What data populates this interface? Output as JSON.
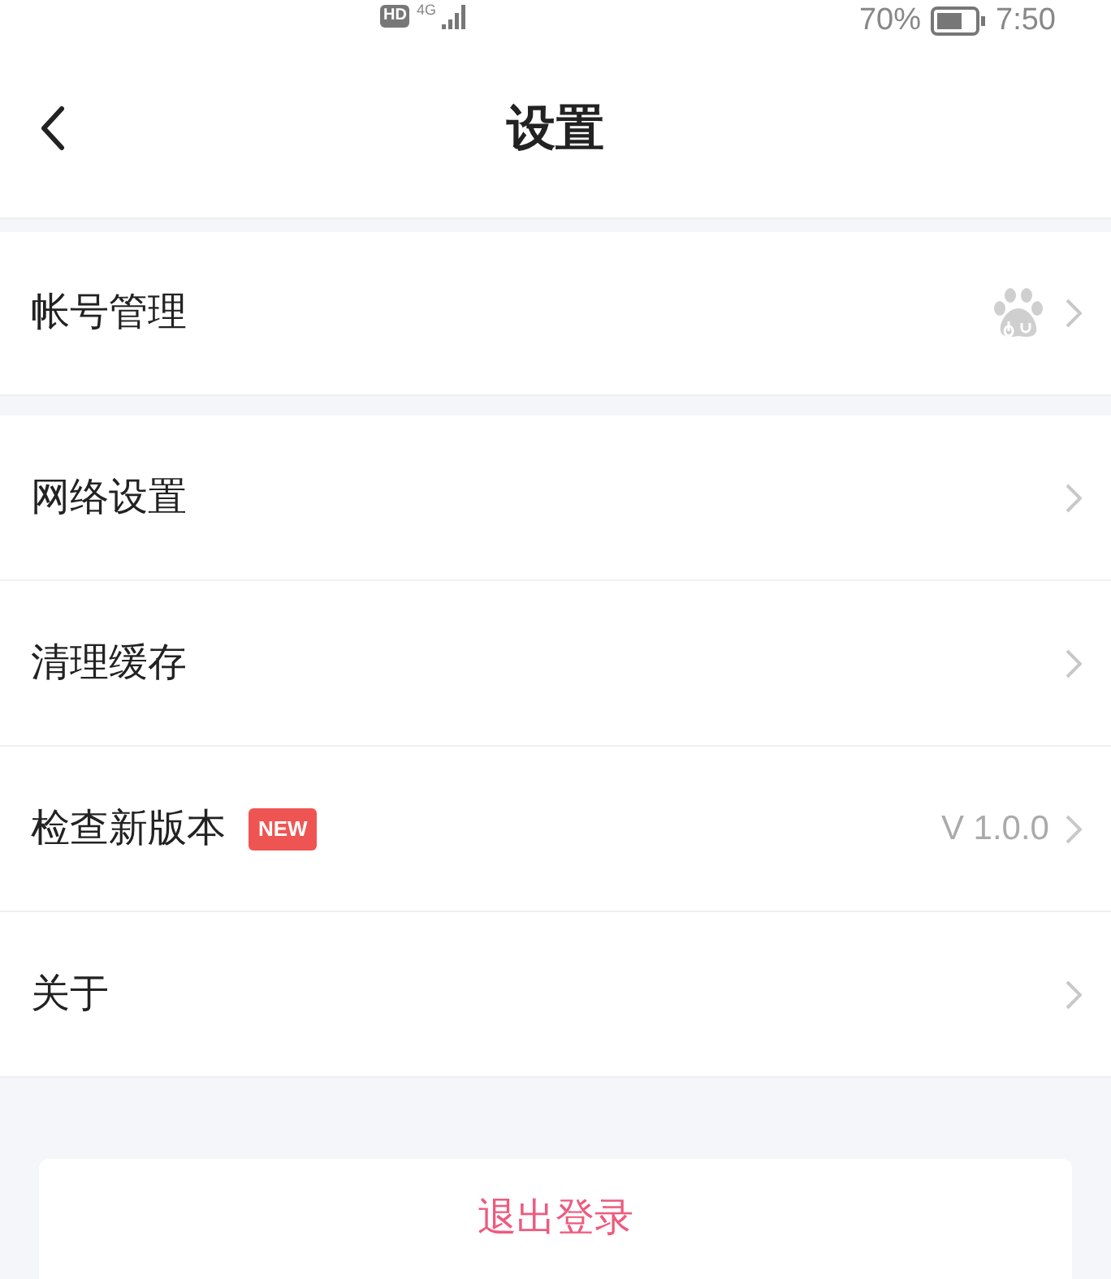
{
  "status_bar": {
    "network_badge": "HD",
    "network_type": "4G",
    "battery": "70%",
    "time": "7:50"
  },
  "header": {
    "title": "设置"
  },
  "sections": [
    {
      "items": [
        {
          "kind": "account",
          "label": "帐号管理"
        }
      ]
    },
    {
      "items": [
        {
          "kind": "link",
          "label": "网络设置"
        },
        {
          "kind": "link",
          "label": "清理缓存"
        },
        {
          "kind": "version",
          "label": "检查新版本",
          "badge": "NEW",
          "value": "V 1.0.0"
        },
        {
          "kind": "link",
          "label": "关于"
        }
      ]
    }
  ],
  "logout_button": "退出登录"
}
